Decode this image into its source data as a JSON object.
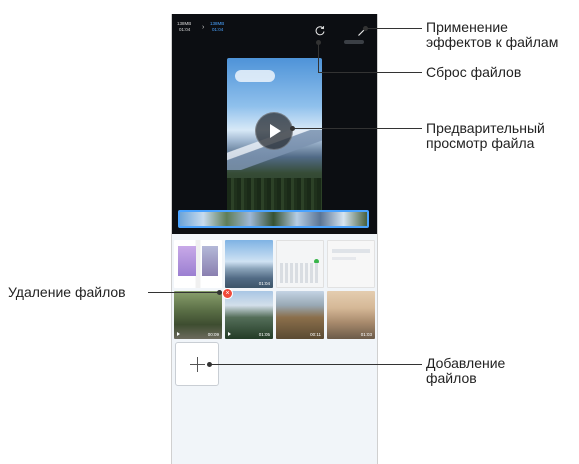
{
  "editor": {
    "size_old": "138MB",
    "duration_old": "01:04",
    "size_new": "138MB",
    "duration_new": "01:04",
    "reset_icon": "reset-icon",
    "effects_icon": "magic-wand-icon"
  },
  "files": [
    {
      "duration": ""
    },
    {
      "duration": "01:04"
    },
    {
      "duration": ""
    },
    {
      "duration": ""
    },
    {
      "duration": "00:09"
    },
    {
      "duration": "01:05"
    },
    {
      "duration": "00:11"
    },
    {
      "duration": "01:03"
    }
  ],
  "callouts": {
    "apply_effects": "Применение\nэффектов к файлам",
    "reset_files": "Сброс файлов",
    "preview_file": "Предварительный\nпросмотр файла",
    "delete_files": "Удаление файлов",
    "add_files": "Добавление\nфайлов"
  },
  "colors": {
    "accent": "#4aa3ff",
    "delete": "#f04a3a"
  }
}
